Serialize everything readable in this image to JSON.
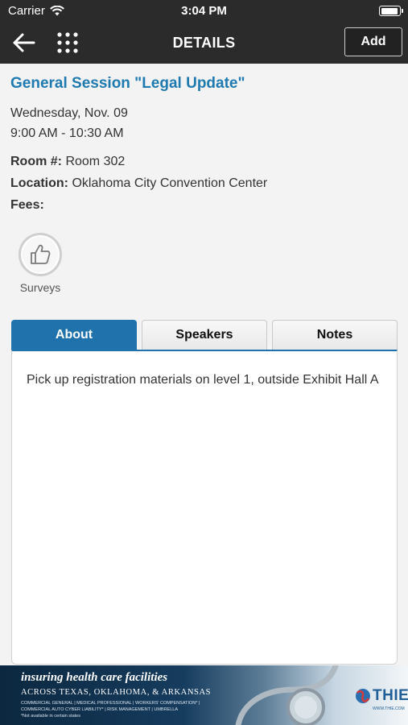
{
  "status_bar": {
    "carrier": "Carrier",
    "time": "3:04 PM",
    "battery_level": 0.95
  },
  "navbar": {
    "title": "DETAILS",
    "add_label": "Add",
    "back_icon": "back-arrow-icon",
    "menu_icon": "grid-menu-icon"
  },
  "session": {
    "title": "General Session \"Legal Update\"",
    "date": "Wednesday, Nov. 09",
    "time": "9:00 AM - 10:30 AM",
    "room_label": "Room #:",
    "room_value": "Room 302",
    "location_label": "Location:",
    "location_value": "Oklahoma City Convention Center",
    "fees_label": "Fees:",
    "fees_value": ""
  },
  "survey": {
    "label": "Surveys",
    "icon": "thumbs-up-icon"
  },
  "tabs": [
    {
      "label": "About",
      "active": true
    },
    {
      "label": "Speakers",
      "active": false
    },
    {
      "label": "Notes",
      "active": false
    }
  ],
  "about_text": "Pick up registration materials on level 1, outside Exhibit Hall A",
  "banner": {
    "headline": "insuring health care facilities",
    "subline": "ACROSS TEXAS, OKLAHOMA, & ARKANSAS",
    "lines_of_business": "COMMERCIAL GENERAL | MEDICAL PROFESSIONAL | WORKERS' COMPENSATION* | COMMERCIAL AUTO CYBER LIABILITY* | RISK MANAGEMENT | UMBRELLA",
    "footnote": "*Not available in certain states",
    "logo_text": "THIE",
    "logo_url": "WWW.THIE.COM"
  },
  "colors": {
    "accent": "#1f72ab",
    "title": "#1f7ab0",
    "bar": "#2b2b2b"
  }
}
